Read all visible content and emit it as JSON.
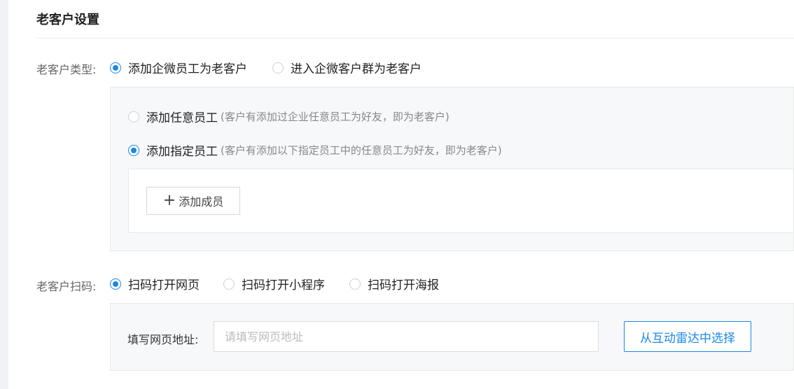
{
  "section": {
    "title": "老客户设置"
  },
  "customer_type": {
    "label": "老客户类型:",
    "options": [
      {
        "label": "添加企微员工为老客户",
        "checked": true
      },
      {
        "label": "进入企微客户群为老客户",
        "checked": false
      }
    ],
    "sub_options": [
      {
        "label": "添加任意员工",
        "hint": "(客户有添加过企业任意员工为好友，即为老客户)",
        "checked": false
      },
      {
        "label": "添加指定员工",
        "hint": "(客户有添加以下指定员工中的任意员工为好友，即为老客户)",
        "checked": true
      }
    ],
    "add_member_label": "添加成员"
  },
  "scan": {
    "label": "老客户扫码:",
    "options": [
      {
        "label": "扫码打开网页",
        "checked": true
      },
      {
        "label": "扫码打开小程序",
        "checked": false
      },
      {
        "label": "扫码打开海报",
        "checked": false
      }
    ],
    "url_label": "填写网页地址:",
    "url_value": "",
    "url_placeholder": "请填写网页地址",
    "radar_button": "从互动雷达中选择"
  },
  "colors": {
    "accent": "#1a88e8",
    "panel_bg": "#f7f8fa",
    "page_bg": "#f0f2f5"
  }
}
